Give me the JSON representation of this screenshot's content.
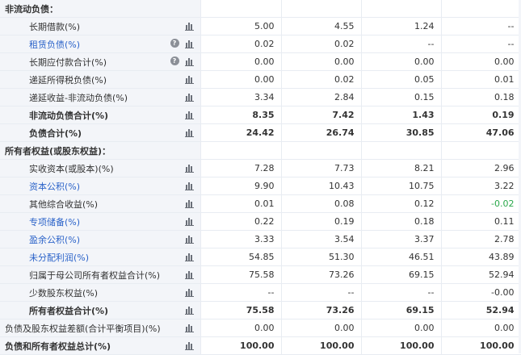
{
  "rows": [
    {
      "label": "非流动负债：",
      "type": "section"
    },
    {
      "label": "长期借款(%)",
      "values": [
        "5.00",
        "4.55",
        "1.24",
        "--"
      ],
      "style": "normal",
      "help": false
    },
    {
      "label": "租赁负债(%)",
      "values": [
        "0.02",
        "0.02",
        "--",
        "--"
      ],
      "style": "link",
      "help": true
    },
    {
      "label": "长期应付款合计(%)",
      "values": [
        "0.00",
        "0.00",
        "0.00",
        "0.00"
      ],
      "style": "normal",
      "help": true
    },
    {
      "label": "递延所得税负债(%)",
      "values": [
        "0.00",
        "0.02",
        "0.05",
        "0.01"
      ],
      "style": "normal",
      "help": false
    },
    {
      "label": "递延收益-非流动负债(%)",
      "values": [
        "3.34",
        "2.84",
        "0.15",
        "0.18"
      ],
      "style": "normal",
      "help": false
    },
    {
      "label": "非流动负债合计(%)",
      "values": [
        "8.35",
        "7.42",
        "1.43",
        "0.19"
      ],
      "style": "bold",
      "help": false
    },
    {
      "label": "负债合计(%)",
      "values": [
        "24.42",
        "26.74",
        "30.85",
        "47.06"
      ],
      "style": "bold",
      "help": false
    },
    {
      "label": "所有者权益(或股东权益)：",
      "type": "section"
    },
    {
      "label": "实收资本(或股本)(%)",
      "values": [
        "7.28",
        "7.73",
        "8.21",
        "2.96"
      ],
      "style": "normal",
      "help": false
    },
    {
      "label": "资本公积(%)",
      "values": [
        "9.90",
        "10.43",
        "10.75",
        "3.22"
      ],
      "style": "link",
      "help": false
    },
    {
      "label": "其他综合收益(%)",
      "values": [
        "0.01",
        "0.08",
        "0.12",
        "-0.02"
      ],
      "style": "normal",
      "help": false
    },
    {
      "label": "专项储备(%)",
      "values": [
        "0.22",
        "0.19",
        "0.18",
        "0.11"
      ],
      "style": "link",
      "help": false
    },
    {
      "label": "盈余公积(%)",
      "values": [
        "3.33",
        "3.54",
        "3.37",
        "2.78"
      ],
      "style": "link",
      "help": false
    },
    {
      "label": "未分配利润(%)",
      "values": [
        "54.85",
        "51.30",
        "46.51",
        "43.89"
      ],
      "style": "link",
      "help": false
    },
    {
      "label": "归属于母公司所有者权益合计(%)",
      "values": [
        "75.58",
        "73.26",
        "69.15",
        "52.94"
      ],
      "style": "normal",
      "help": false
    },
    {
      "label": "少数股东权益(%)",
      "values": [
        "--",
        "--",
        "--",
        "-0.00"
      ],
      "style": "normal",
      "help": false
    },
    {
      "label": "所有者权益合计(%)",
      "values": [
        "75.58",
        "73.26",
        "69.15",
        "52.94"
      ],
      "style": "bold",
      "help": false
    },
    {
      "label": "负债及股东权益差额(合计平衡项目)(%)",
      "values": [
        "0.00",
        "0.00",
        "0.00",
        "0.00"
      ],
      "style": "normal-left",
      "help": false
    },
    {
      "label": "负债和所有者权益总计(%)",
      "values": [
        "100.00",
        "100.00",
        "100.00",
        "100.00"
      ],
      "style": "bold-left",
      "help": false
    }
  ],
  "colors": {
    "link": "#2b63c9",
    "negative": "#2aa84a",
    "label_bg": "#f3f5f9",
    "border": "#e8ecf2"
  },
  "icons": {
    "chart": "bar-chart-icon",
    "help": "question-icon"
  }
}
